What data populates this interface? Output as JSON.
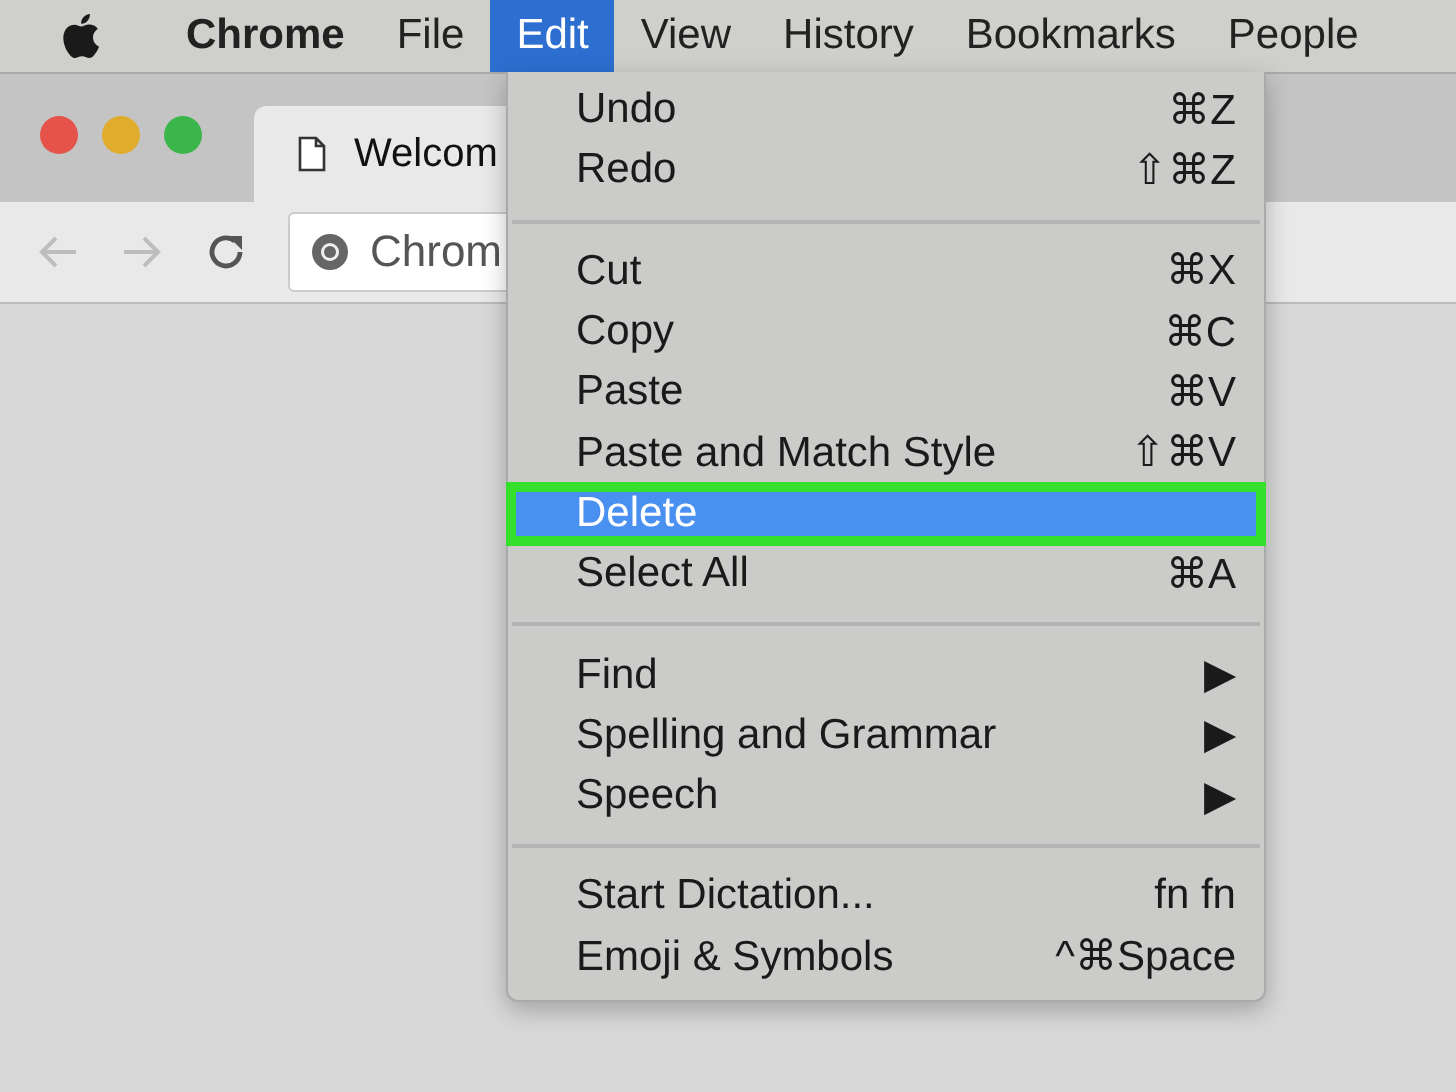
{
  "menu_bar": [
    {
      "label": "Chrome",
      "bold": true,
      "selected": false
    },
    {
      "label": "File",
      "bold": false,
      "selected": false
    },
    {
      "label": "Edit",
      "bold": false,
      "selected": true
    },
    {
      "label": "View",
      "bold": false,
      "selected": false
    },
    {
      "label": "History",
      "bold": false,
      "selected": false
    },
    {
      "label": "Bookmarks",
      "bold": false,
      "selected": false
    },
    {
      "label": "People",
      "bold": false,
      "selected": false
    }
  ],
  "browser": {
    "tab_title": "Welcom",
    "address": "Chrom"
  },
  "edit_menu": {
    "groups": [
      [
        {
          "label": "Undo",
          "shortcut": "⌘Z",
          "selected": false
        },
        {
          "label": "Redo",
          "shortcut": "⇧⌘Z",
          "selected": false
        }
      ],
      [
        {
          "label": "Cut",
          "shortcut": "⌘X",
          "selected": false
        },
        {
          "label": "Copy",
          "shortcut": "⌘C",
          "selected": false
        },
        {
          "label": "Paste",
          "shortcut": "⌘V",
          "selected": false
        },
        {
          "label": "Paste and Match Style",
          "shortcut": "⇧⌘V",
          "selected": false
        },
        {
          "label": "Delete",
          "selected": true
        },
        {
          "label": "Select All",
          "shortcut": "⌘A",
          "selected": false
        }
      ],
      [
        {
          "label": "Find",
          "shortcut": "▶",
          "selected": false
        },
        {
          "label": "Spelling and Grammar",
          "shortcut": "▶",
          "selected": false
        },
        {
          "label": "Speech",
          "shortcut": "▶",
          "selected": false
        }
      ],
      [
        {
          "label": "Start Dictation...",
          "shortcut": "fn fn",
          "selected": false
        },
        {
          "label": "Emoji & Symbols",
          "shortcut": "^⌘Space",
          "selected": false
        }
      ]
    ]
  }
}
